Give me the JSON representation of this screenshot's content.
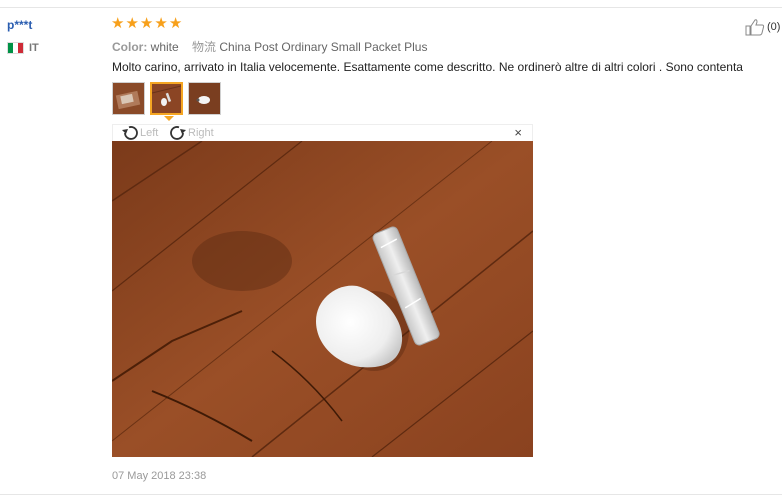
{
  "review": {
    "user": "p***t",
    "country_code": "IT",
    "stars": 5,
    "color_label": "Color:",
    "color_value": "white",
    "shipping_label": "物流",
    "shipping_value": "China Post Ordinary Small Packet Plus",
    "like_count": "(0)",
    "text": "Molto carino, arrivato in Italia velocemente. Esattamente come descritto. Ne ordinerò altre di altri colori . Sono contenta",
    "date": "07 May 2018 23:38"
  },
  "viewer": {
    "rotate_left_label": "Left",
    "rotate_right_label": "Right",
    "close_icon": "×"
  },
  "icons": {
    "star": "star-icon",
    "like": "thumbs-up-icon",
    "rotate_left": "rotate-left-icon",
    "rotate_right": "rotate-right-icon",
    "close": "close-icon",
    "flag": "italy-flag-icon"
  },
  "colors": {
    "username": "#2a5db0",
    "stars": "#f7a01b",
    "active_thumb": "#f5a623",
    "flag_green": "#009246",
    "flag_white": "#ffffff",
    "flag_red": "#ce2b37"
  }
}
